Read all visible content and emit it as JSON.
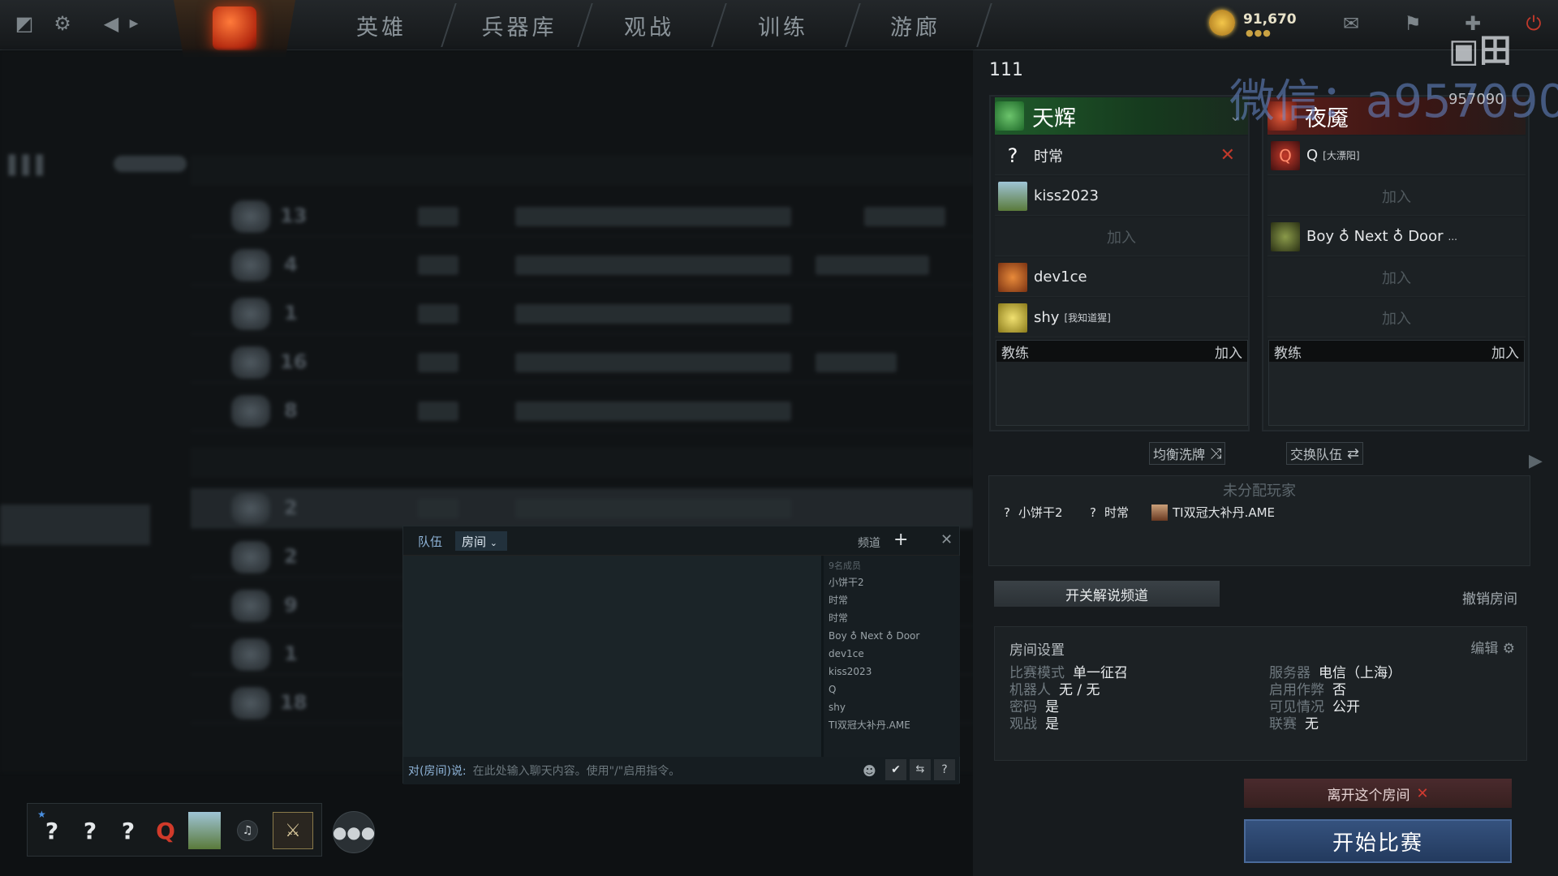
{
  "topbar": {
    "nav": [
      "英雄",
      "兵器库",
      "观战",
      "训练",
      "游廊"
    ],
    "gold": "91,670"
  },
  "lobby": {
    "title": "111",
    "radiant": {
      "name": "天辉",
      "players": [
        {
          "name": "时常",
          "tag": "",
          "kickable": true
        },
        {
          "name": "kiss2023",
          "tag": ""
        },
        {
          "name": "",
          "tag": "",
          "join": "加入"
        },
        {
          "name": "dev1ce",
          "tag": ""
        },
        {
          "name": "shy",
          "tag": "[我知道猩]"
        }
      ],
      "coach_label": "教练",
      "coach_join": "加入"
    },
    "dire": {
      "name": "夜魇",
      "players": [
        {
          "name": "Q",
          "tag": "[大漂阳]"
        },
        {
          "name": "",
          "tag": "",
          "join": "加入"
        },
        {
          "name": "Boy ♁ Next ♁ Door",
          "tag": "..."
        },
        {
          "name": "",
          "tag": "",
          "join": "加入"
        },
        {
          "name": "",
          "tag": "",
          "join": "加入"
        }
      ],
      "coach_label": "教练",
      "coach_join": "加入"
    },
    "balance_button": "均衡洗牌",
    "swap_button": "交换队伍",
    "unassigned_title": "未分配玩家",
    "unassigned": [
      {
        "icon": "?",
        "name": "小饼干2"
      },
      {
        "icon": "?",
        "name": "时常"
      },
      {
        "icon": "",
        "name": "TI双冠大补丹.AME"
      }
    ],
    "broadcast_button": "开关解说频道",
    "cancel_room": "撤销房间",
    "settings": {
      "title": "房间设置",
      "edit": "编辑",
      "rows": [
        {
          "label": "比赛模式",
          "value": "单一征召"
        },
        {
          "label": "机器人",
          "value": "无 / 无"
        },
        {
          "label": "密码",
          "value": "是"
        },
        {
          "label": "观战",
          "value": "是"
        },
        {
          "label": "服务器",
          "value": "电信（上海）"
        },
        {
          "label": "启用作弊",
          "value": "否"
        },
        {
          "label": "可见情况",
          "value": "公开"
        },
        {
          "label": "联赛",
          "value": "无"
        }
      ]
    },
    "leave_button": "离开这个房间",
    "start_button": "开始比赛"
  },
  "chat": {
    "tab_team": "队伍",
    "tab_room": "房间",
    "channel": "频道",
    "member_count": "9名成员",
    "members": [
      "小饼干2",
      "时常",
      "时常",
      "Boy ♁ Next ♁ Door",
      "dev1ce",
      "kiss2023",
      "Q",
      "shy",
      "TI双冠大补丹.AME"
    ],
    "input_prefix": "对(房间)说:",
    "input_placeholder": "在此处输入聊天内容。使用\"/\"启用指令。"
  },
  "watermark": {
    "text": "微信：a957090",
    "sub": "957090"
  },
  "party": {
    "slots": [
      "?",
      "?",
      "?"
    ]
  }
}
